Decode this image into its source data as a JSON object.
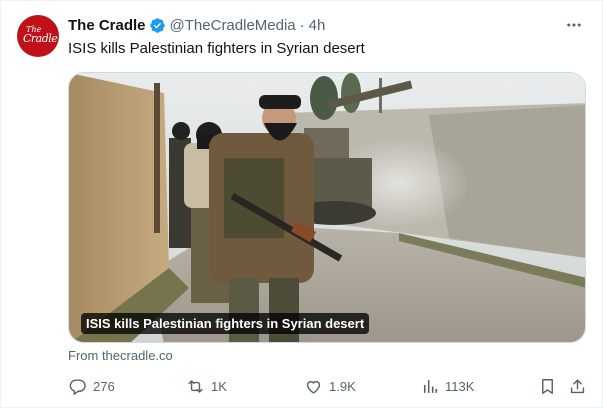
{
  "author": {
    "name": "The Cradle",
    "handle": "@TheCradleMedia",
    "separator": "·",
    "time": "4h",
    "avatar_logo_small": "The",
    "avatar_logo_main": "Cradle",
    "verified_icon": "verified-badge-icon"
  },
  "tweet": {
    "text": "ISIS kills Palestinian fighters in Syrian desert"
  },
  "card": {
    "caption": "ISIS kills Palestinian fighters in Syrian desert",
    "source": "From thecradle.co"
  },
  "actions": {
    "replies": "276",
    "reposts": "1K",
    "likes": "1.9K",
    "views": "113K"
  },
  "colors": {
    "accent": "#1d9bf0",
    "brand": "#c0111a",
    "muted": "#536471"
  }
}
